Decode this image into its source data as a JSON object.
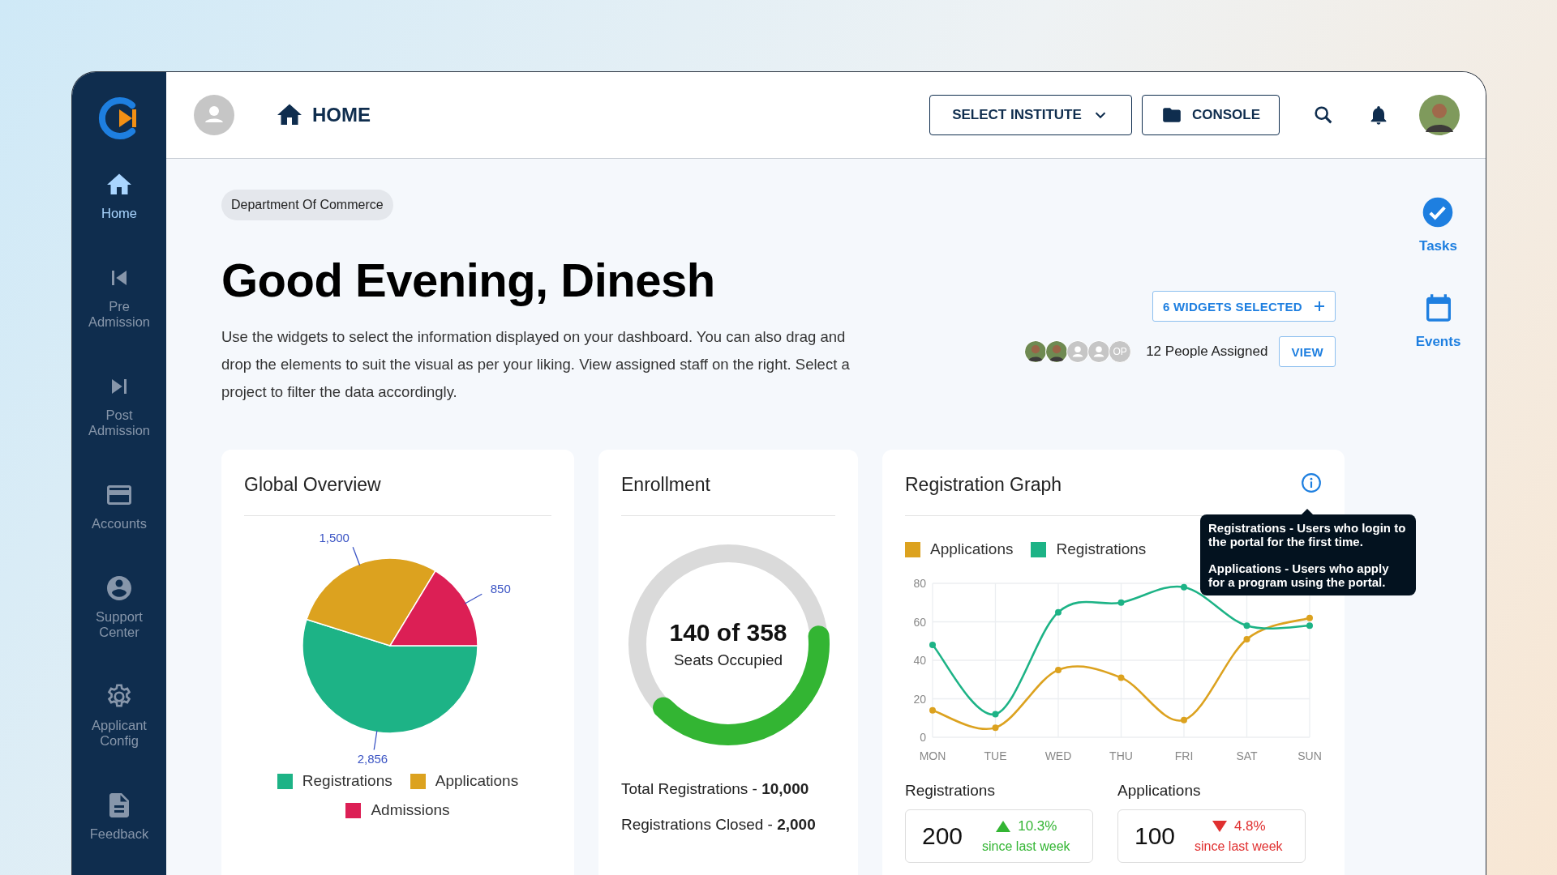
{
  "sidebar": {
    "items": [
      {
        "label": "Home",
        "selected": true
      },
      {
        "label": "Pre Admission",
        "selected": false
      },
      {
        "label": "Post Admission",
        "selected": false
      },
      {
        "label": "Accounts",
        "selected": false
      },
      {
        "label": "Support Center",
        "selected": false
      },
      {
        "label": "Applicant Config",
        "selected": false
      },
      {
        "label": "Feedback",
        "selected": false
      }
    ]
  },
  "header": {
    "title": "HOME",
    "institute_button": "SELECT INSTITUTE",
    "console_button": "CONSOLE"
  },
  "department_chip": "Department Of Commerce",
  "greeting": "Good Evening, Dinesh",
  "description": "Use the widgets to select the information displayed on your dashboard. You can also drag and drop the elements to suit the visual as per your liking. View assigned staff on the right. Select a project to filter the data accordingly.",
  "widgets_button": "6 WIDGETS SELECTED",
  "people": {
    "avatars": [
      {
        "kind": "photo"
      },
      {
        "kind": "photo"
      },
      {
        "kind": "placeholder"
      },
      {
        "kind": "placeholder"
      },
      {
        "kind": "initials",
        "text": "OP"
      }
    ],
    "label": "12 People Assigned",
    "view_button": "VIEW"
  },
  "global_overview": {
    "title": "Global Overview",
    "chart_data": {
      "type": "pie",
      "categories": [
        "Registrations",
        "Applications",
        "Admissions"
      ],
      "values": [
        2856,
        1500,
        850
      ],
      "colors": [
        "#1db386",
        "#dca21f",
        "#dc1f55"
      ],
      "value_labels": [
        "2,856",
        "1,500",
        "850"
      ]
    }
  },
  "enrollment": {
    "title": "Enrollment",
    "gauge": {
      "value_text": "140 of 358",
      "caption": "Seats Occupied",
      "level": 0.39
    },
    "stats": [
      "Total Registrations - **10,000**",
      "Registrations Closed - **2,000**"
    ]
  },
  "registration_graph": {
    "title": "Registration Graph",
    "tooltip": [
      "Registrations - Users who login to the portal for the first time.",
      "Applications - Users who apply for a program using the portal."
    ],
    "chart_data": {
      "type": "line",
      "x": [
        "MON",
        "TUE",
        "WED",
        "THU",
        "FRI",
        "SAT",
        "SUN"
      ],
      "ylim": [
        0,
        80
      ],
      "yticks": [
        0,
        20,
        40,
        60,
        80
      ],
      "grid": true,
      "series": [
        {
          "name": "Applications",
          "color": "#dca21f",
          "marker": true,
          "values": [
            14,
            5,
            35,
            31,
            9,
            51,
            62
          ]
        },
        {
          "name": "Registrations",
          "color": "#1db386",
          "marker": true,
          "values": [
            48,
            12,
            65,
            70,
            78,
            58,
            58
          ]
        }
      ]
    },
    "stat_cards": [
      {
        "label": "Registrations",
        "value": "200",
        "kind": "up",
        "change": "10.3%",
        "note": "since last week"
      },
      {
        "label": "Applications",
        "value": "100",
        "kind": "down",
        "change": "4.8%",
        "note": "since last week"
      }
    ]
  },
  "right_rail": [
    {
      "label": "Tasks"
    },
    {
      "label": "Events"
    }
  ]
}
